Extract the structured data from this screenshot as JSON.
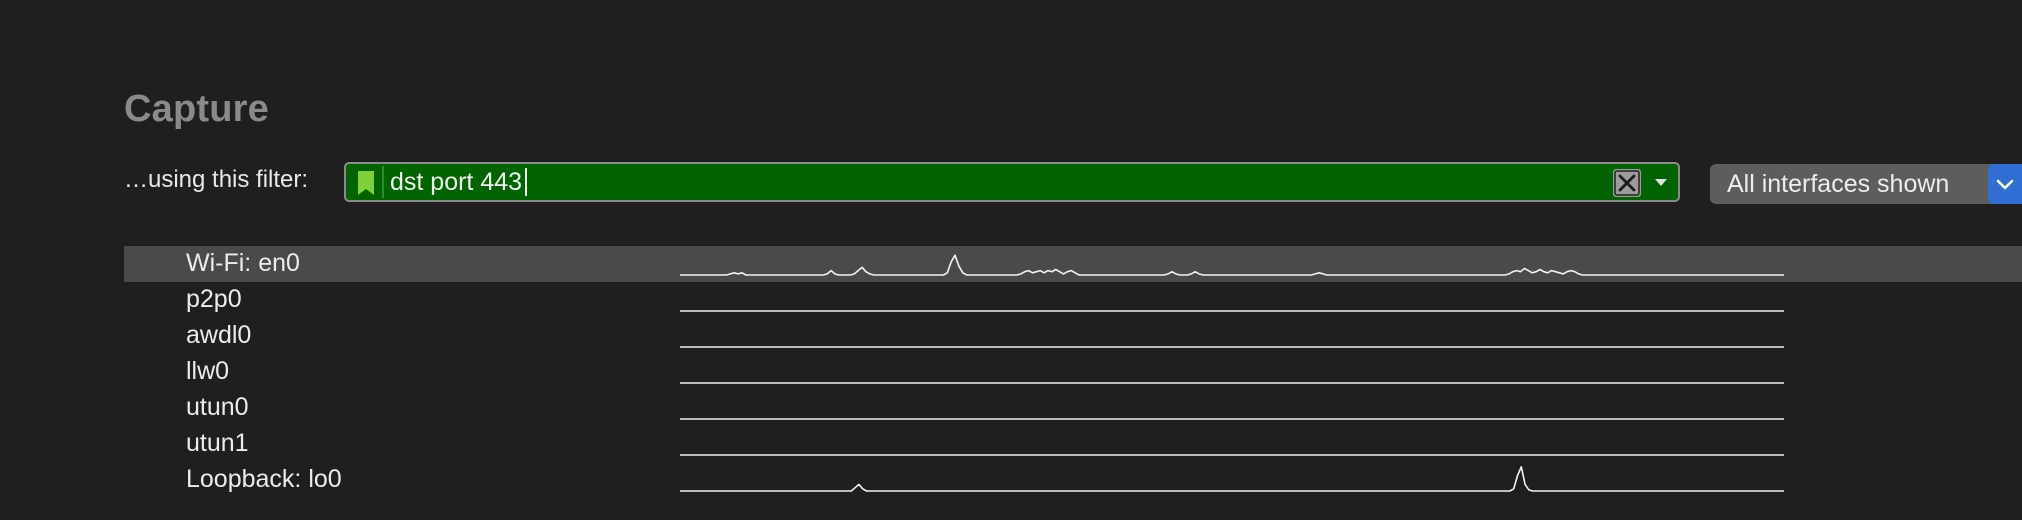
{
  "section": {
    "title": "Capture"
  },
  "filter": {
    "label": "…using this filter:",
    "value": "dst port 443",
    "field_color": "#016401",
    "bookmark_color": "#7fd13b",
    "bookmark_icon": "bookmark-icon",
    "clear_icon": "clear-x-icon",
    "dropdown_icon": "chevron-down-icon"
  },
  "interface_selector": {
    "selected": "All interfaces shown",
    "accent_color": "#2f6fd3"
  },
  "interfaces": [
    {
      "name": "Wi-Fi: en0",
      "selected": true,
      "traffic": [
        0,
        0,
        0,
        0,
        0,
        0,
        0,
        0,
        0,
        0,
        0,
        0,
        0,
        1,
        2,
        1,
        2,
        0,
        0,
        0,
        0,
        0,
        0,
        0,
        0,
        0,
        0,
        0,
        0,
        0,
        0,
        0,
        0,
        0,
        0,
        0,
        0,
        0,
        1,
        4,
        1,
        0,
        0,
        0,
        0,
        1,
        4,
        7,
        3,
        1,
        0,
        0,
        0,
        0,
        0,
        0,
        0,
        0,
        0,
        0,
        0,
        0,
        0,
        0,
        0,
        0,
        0,
        0,
        0,
        2,
        12,
        18,
        8,
        2,
        0,
        0,
        0,
        0,
        0,
        0,
        0,
        0,
        0,
        0,
        0,
        0,
        0,
        0,
        1,
        3,
        4,
        2,
        3,
        4,
        2,
        4,
        3,
        5,
        3,
        1,
        3,
        4,
        2,
        0,
        0,
        0,
        0,
        0,
        0,
        0,
        0,
        0,
        0,
        0,
        0,
        0,
        0,
        0,
        0,
        0,
        0,
        0,
        0,
        0,
        0,
        0,
        1,
        3,
        1,
        0,
        0,
        0,
        1,
        3,
        1,
        0,
        0,
        0,
        0,
        0,
        0,
        0,
        0,
        0,
        0,
        0,
        0,
        0,
        0,
        0,
        0,
        0,
        0,
        0,
        0,
        0,
        0,
        0,
        0,
        0,
        0,
        0,
        0,
        0,
        1,
        2,
        1,
        0,
        0,
        0,
        0,
        0,
        0,
        0,
        0,
        0,
        0,
        0,
        0,
        0,
        0,
        0,
        0,
        0,
        0,
        0,
        0,
        0,
        0,
        0,
        0,
        0,
        0,
        0,
        0,
        0,
        0,
        0,
        0,
        0,
        0,
        0,
        0,
        0,
        0,
        0,
        0,
        0,
        0,
        0,
        0,
        0,
        0,
        0,
        1,
        3,
        4,
        3,
        6,
        4,
        2,
        3,
        5,
        3,
        2,
        4,
        3,
        2,
        1,
        3,
        4,
        3,
        1,
        0,
        0,
        0,
        0,
        0,
        0,
        0,
        0,
        0,
        0,
        0,
        0,
        0,
        0,
        0,
        0,
        0,
        0,
        0,
        0,
        0,
        0,
        0,
        0,
        0,
        0,
        0,
        0,
        0,
        0,
        0,
        0,
        0,
        0,
        0,
        0,
        0,
        0,
        0,
        0,
        0,
        0,
        0,
        0,
        0,
        0,
        0,
        0,
        0,
        0,
        0,
        0,
        0
      ]
    },
    {
      "name": "p2p0",
      "selected": false,
      "traffic": []
    },
    {
      "name": "awdl0",
      "selected": false,
      "traffic": []
    },
    {
      "name": "llw0",
      "selected": false,
      "traffic": []
    },
    {
      "name": "utun0",
      "selected": false,
      "traffic": []
    },
    {
      "name": "utun1",
      "selected": false,
      "traffic": []
    },
    {
      "name": "Loopback: lo0",
      "selected": false,
      "traffic": [
        0,
        0,
        0,
        0,
        0,
        0,
        0,
        0,
        0,
        0,
        0,
        0,
        0,
        0,
        0,
        0,
        0,
        0,
        0,
        0,
        0,
        0,
        0,
        0,
        0,
        0,
        0,
        0,
        0,
        0,
        0,
        0,
        0,
        0,
        0,
        0,
        0,
        0,
        0,
        0,
        0,
        0,
        0,
        0,
        0,
        0,
        3,
        6,
        2,
        0,
        0,
        0,
        0,
        0,
        0,
        0,
        0,
        0,
        0,
        0,
        0,
        0,
        0,
        0,
        0,
        0,
        0,
        0,
        0,
        0,
        0,
        0,
        0,
        0,
        0,
        0,
        0,
        0,
        0,
        0,
        0,
        0,
        0,
        0,
        0,
        0,
        0,
        0,
        0,
        0,
        0,
        0,
        0,
        0,
        0,
        0,
        0,
        0,
        0,
        0,
        0,
        0,
        0,
        0,
        0,
        0,
        0,
        0,
        0,
        0,
        0,
        0,
        0,
        0,
        0,
        0,
        0,
        0,
        0,
        0,
        0,
        0,
        0,
        0,
        0,
        0,
        0,
        0,
        0,
        0,
        0,
        0,
        0,
        0,
        0,
        0,
        0,
        0,
        0,
        0,
        0,
        0,
        0,
        0,
        0,
        0,
        0,
        0,
        0,
        0,
        0,
        0,
        0,
        0,
        0,
        0,
        0,
        0,
        0,
        0,
        0,
        0,
        0,
        0,
        0,
        0,
        0,
        0,
        0,
        0,
        0,
        0,
        0,
        0,
        0,
        0,
        0,
        0,
        0,
        0,
        0,
        0,
        0,
        0,
        0,
        0,
        0,
        0,
        0,
        0,
        0,
        0,
        0,
        0,
        0,
        0,
        0,
        0,
        0,
        0,
        0,
        0,
        0,
        0,
        0,
        0,
        0,
        0,
        0,
        0,
        0,
        0,
        0,
        0,
        0,
        0,
        0,
        0,
        0,
        2,
        14,
        22,
        6,
        1,
        0,
        0,
        0,
        0,
        0,
        0,
        0,
        0,
        0,
        0,
        0,
        0,
        0,
        0,
        0,
        0,
        0,
        0,
        0,
        0,
        0,
        0,
        0,
        0,
        0,
        0,
        0,
        0,
        0,
        0,
        0,
        0,
        0,
        0,
        0,
        0,
        0,
        0,
        0,
        0,
        0,
        0,
        0,
        0,
        0,
        0,
        0,
        0,
        0,
        0,
        0,
        0,
        0,
        0,
        0,
        0,
        0,
        0,
        0,
        0,
        0,
        0,
        0,
        0,
        0,
        0,
        0
      ]
    }
  ]
}
